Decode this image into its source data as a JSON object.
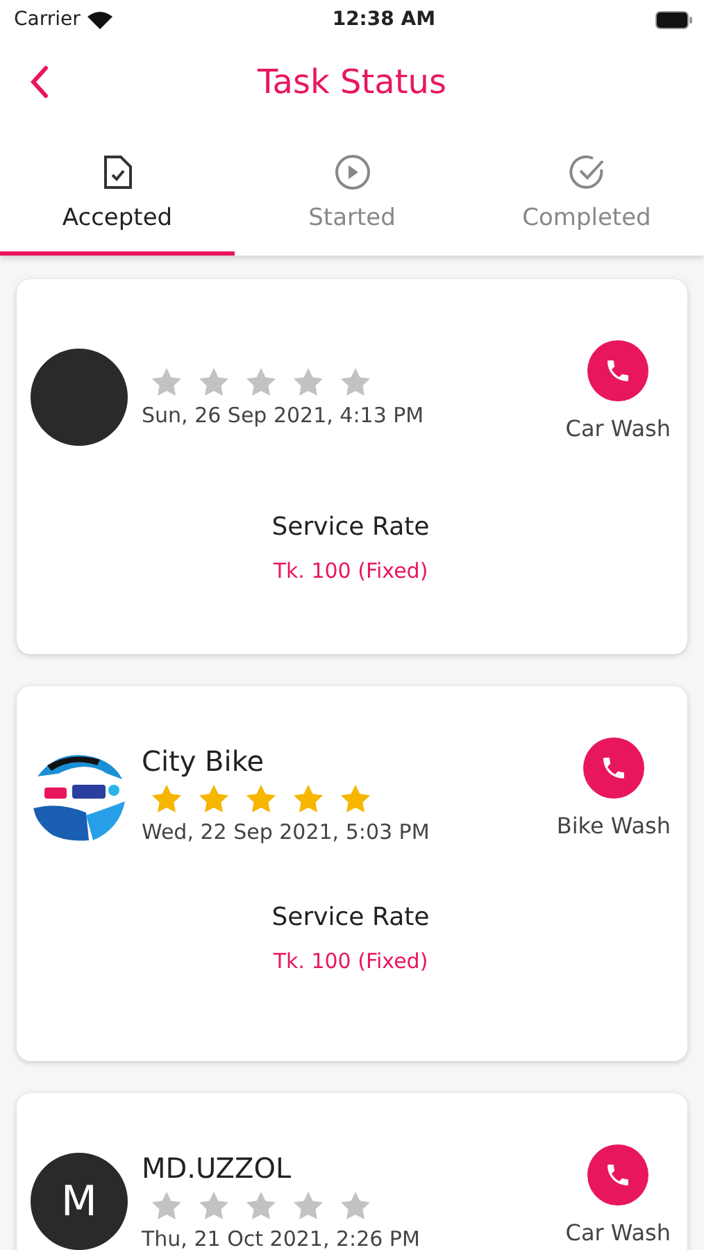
{
  "status_bar": {
    "carrier": "Carrier",
    "time": "12:38 AM"
  },
  "header": {
    "title": "Task Status"
  },
  "tabs": [
    {
      "label": "Accepted",
      "kind": "accepted",
      "selected": true
    },
    {
      "label": "Started",
      "kind": "started",
      "selected": false
    },
    {
      "label": "Completed",
      "kind": "completed",
      "selected": false
    }
  ],
  "tasks": [
    {
      "avatar": {
        "kind": "blank"
      },
      "stars": 0,
      "date": "Sun, 26 Sep 2021, 4:13 PM",
      "service": "Car Wash",
      "rate_label": "Service Rate",
      "rate": "Tk. 100 (Fixed)"
    },
    {
      "name": "City Bike",
      "stars": 5,
      "date": "Wed, 22 Sep 2021, 5:03 PM",
      "service": "Bike Wash",
      "rate_label": "Service Rate",
      "rate": "Tk. 100 (Fixed)"
    },
    {
      "avatar": {
        "kind": "initial",
        "initial": "M"
      },
      "name": "MD.UZZOL",
      "stars": 0,
      "date": "Thu, 21 Oct 2021, 2:26 PM",
      "service": "Car Wash"
    }
  ]
}
